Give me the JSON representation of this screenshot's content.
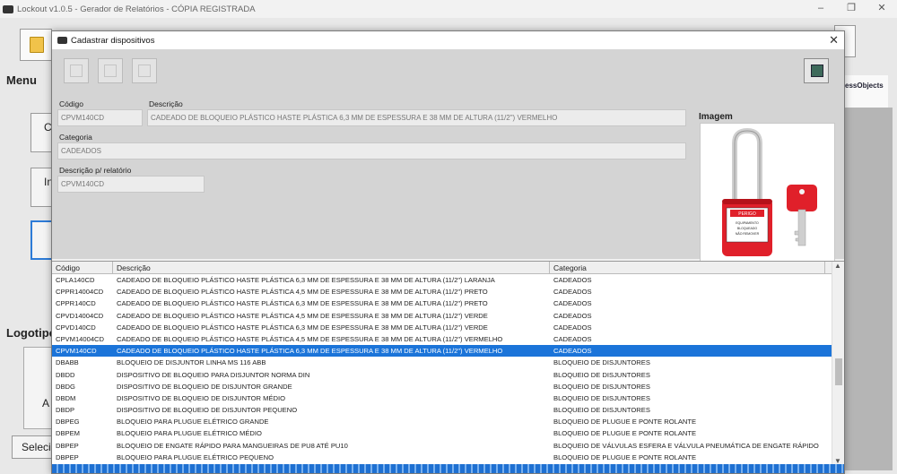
{
  "main_window": {
    "title": "Lockout v1.0.5 - Gerador de Relatórios - CÓPIA REGISTRADA",
    "controls": [
      "–",
      "❐",
      "✕"
    ],
    "menu_heading": "Menu",
    "menu_buttons": [
      "C",
      "In",
      ""
    ],
    "logo_heading": "Logotipo",
    "logo_box_text": "A",
    "select_button": "Selecio",
    "right_logo_text": "essObjects"
  },
  "dialog": {
    "title": "Cadastrar dispositivos",
    "close": "✕",
    "form": {
      "codigo_label": "Código",
      "codigo_value": "CPVM140CD",
      "descricao_label": "Descrição",
      "descricao_value": "CADEADO DE BLOQUEIO PLÁSTICO HASTE PLÁSTICA 6,3 MM DE ESPESSURA E 38 MM DE ALTURA (11/2\") VERMELHO",
      "categoria_label": "Categoria",
      "categoria_value": "CADEADOS",
      "desc_relatorio_label": "Descrição p/ relatório",
      "desc_relatorio_value": "CPVM140CD"
    },
    "image_label": "Imagem",
    "padlock_tag_title": "PERIGO",
    "padlock_tag_lines": [
      "EQUIPAMENTO",
      "BLOQUEADO",
      "NÃO REMOVER"
    ],
    "grid": {
      "headers": [
        "Código",
        "Descrição",
        "Categoria"
      ],
      "selected_index": 6,
      "rows": [
        [
          "CPLA140CD",
          "CADEADO DE BLOQUEIO PLÁSTICO HASTE PLÁSTICA 6,3 MM DE ESPESSURA E 38 MM DE ALTURA (11/2\") LARANJA",
          "CADEADOS"
        ],
        [
          "CPPR14004CD",
          "CADEADO DE BLOQUEIO PLÁSTICO HASTE PLÁSTICA 4,5 MM DE ESPESSURA E 38 MM DE ALTURA (11/2\") PRETO",
          "CADEADOS"
        ],
        [
          "CPPR140CD",
          "CADEADO DE BLOQUEIO PLÁSTICO HASTE PLÁSTICA 6,3 MM DE ESPESSURA E 38 MM DE ALTURA (11/2\") PRETO",
          "CADEADOS"
        ],
        [
          "CPVD14004CD",
          "CADEADO DE BLOQUEIO PLÁSTICO HASTE PLÁSTICA 4,5 MM DE ESPESSURA E 38 MM DE ALTURA (11/2\") VERDE",
          "CADEADOS"
        ],
        [
          "CPVD140CD",
          "CADEADO DE BLOQUEIO PLÁSTICO HASTE PLÁSTICA 6,3 MM DE ESPESSURA E 38 MM DE ALTURA (11/2\") VERDE",
          "CADEADOS"
        ],
        [
          "CPVM14004CD",
          "CADEADO DE BLOQUEIO PLÁSTICO HASTE PLÁSTICA 4,5 MM DE ESPESSURA E 38 MM DE ALTURA (11/2\") VERMELHO",
          "CADEADOS"
        ],
        [
          "CPVM140CD",
          "CADEADO DE BLOQUEIO PLÁSTICO HASTE PLÁSTICA 6,3 MM DE ESPESSURA E 38 MM DE ALTURA (11/2\") VERMELHO",
          "CADEADOS"
        ],
        [
          "DBABB",
          "BLOQUEIO DE DISJUNTOR LINHA MS 116 ABB",
          "BLOQUEIO DE DISJUNTORES"
        ],
        [
          "DBDD",
          "DISPOSITIVO DE BLOQUEIO PARA DISJUNTOR NORMA DIN",
          "BLOQUEIO DE DISJUNTORES"
        ],
        [
          "DBDG",
          "DISPOSITIVO DE BLOQUEIO DE DISJUNTOR GRANDE",
          "BLOQUEIO DE DISJUNTORES"
        ],
        [
          "DBDM",
          "DISPOSITIVO DE BLOQUEIO DE DISJUNTOR MÉDIO",
          "BLOQUEIO DE DISJUNTORES"
        ],
        [
          "DBDP",
          "DISPOSITIVO DE BLOQUEIO DE DISJUNTOR PEQUENO",
          "BLOQUEIO DE DISJUNTORES"
        ],
        [
          "DBPEG",
          "BLOQUEIO PARA PLUGUE ELÉTRICO GRANDE",
          "BLOQUEIO DE PLUGUE E PONTE ROLANTE"
        ],
        [
          "DBPEM",
          "BLOQUEIO PARA PLUGUE ELÉTRICO MÉDIO",
          "BLOQUEIO DE PLUGUE E PONTE ROLANTE"
        ],
        [
          "DBPEP",
          "BLOQUEIO DE ENGATE RÁPIDO PARA MANGUEIRAS DE PU8 ATÉ PU10",
          "BLOQUEIO DE VÁLVULAS ESFERA E VÁLVULA PNEUMÁTICA DE ENGATE RÁPIDO"
        ],
        [
          "DBPEP",
          "BLOQUEIO PARA PLUGUE ELÉTRICO PEQUENO",
          "BLOQUEIO DE PLUGUE E PONTE ROLANTE"
        ]
      ]
    }
  },
  "colors": {
    "selection": "#1b74d9",
    "padlock_red": "#e0202a"
  }
}
